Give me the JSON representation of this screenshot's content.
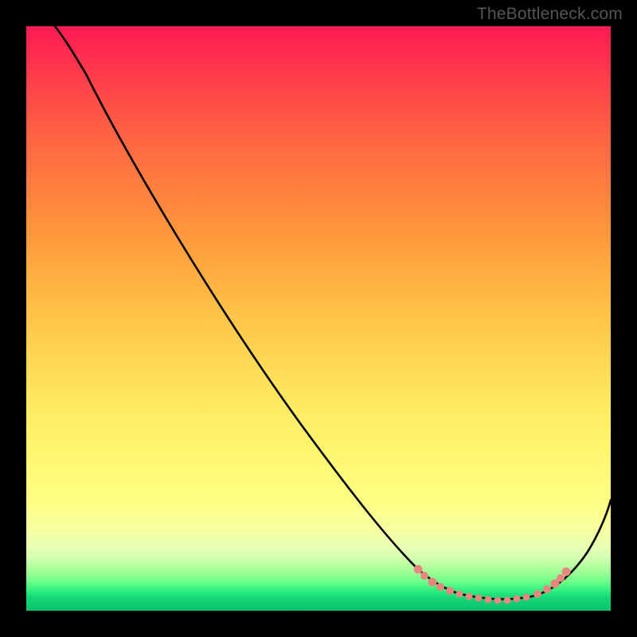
{
  "attribution": "TheBottleneck.com",
  "chart_data": {
    "type": "line",
    "title": "",
    "xlabel": "",
    "ylabel": "",
    "xlim": [
      0,
      100
    ],
    "ylim": [
      0,
      100
    ],
    "grid": false,
    "legend": false,
    "background": "rainbow-vertical-gradient",
    "series": [
      {
        "name": "bottleneck-curve",
        "color": "#000000",
        "x": [
          5,
          8,
          12,
          18,
          25,
          32,
          40,
          48,
          56,
          63,
          68,
          72,
          75,
          78,
          81,
          84,
          87,
          90,
          93,
          96,
          100
        ],
        "y": [
          100,
          97,
          93,
          86,
          77,
          68,
          58,
          48,
          38,
          28,
          20,
          13,
          8,
          5,
          3,
          2,
          2,
          3,
          6,
          12,
          22
        ]
      },
      {
        "name": "sweet-spot-markers",
        "type": "scatter",
        "color": "#e8877f",
        "x": [
          68,
          70,
          72,
          74,
          76,
          78,
          80,
          82,
          84,
          86,
          88,
          90
        ],
        "y": [
          6.5,
          5.5,
          4.7,
          4.0,
          3.5,
          3.3,
          3.2,
          3.2,
          3.4,
          3.9,
          4.8,
          6.2
        ]
      }
    ],
    "annotations": []
  }
}
